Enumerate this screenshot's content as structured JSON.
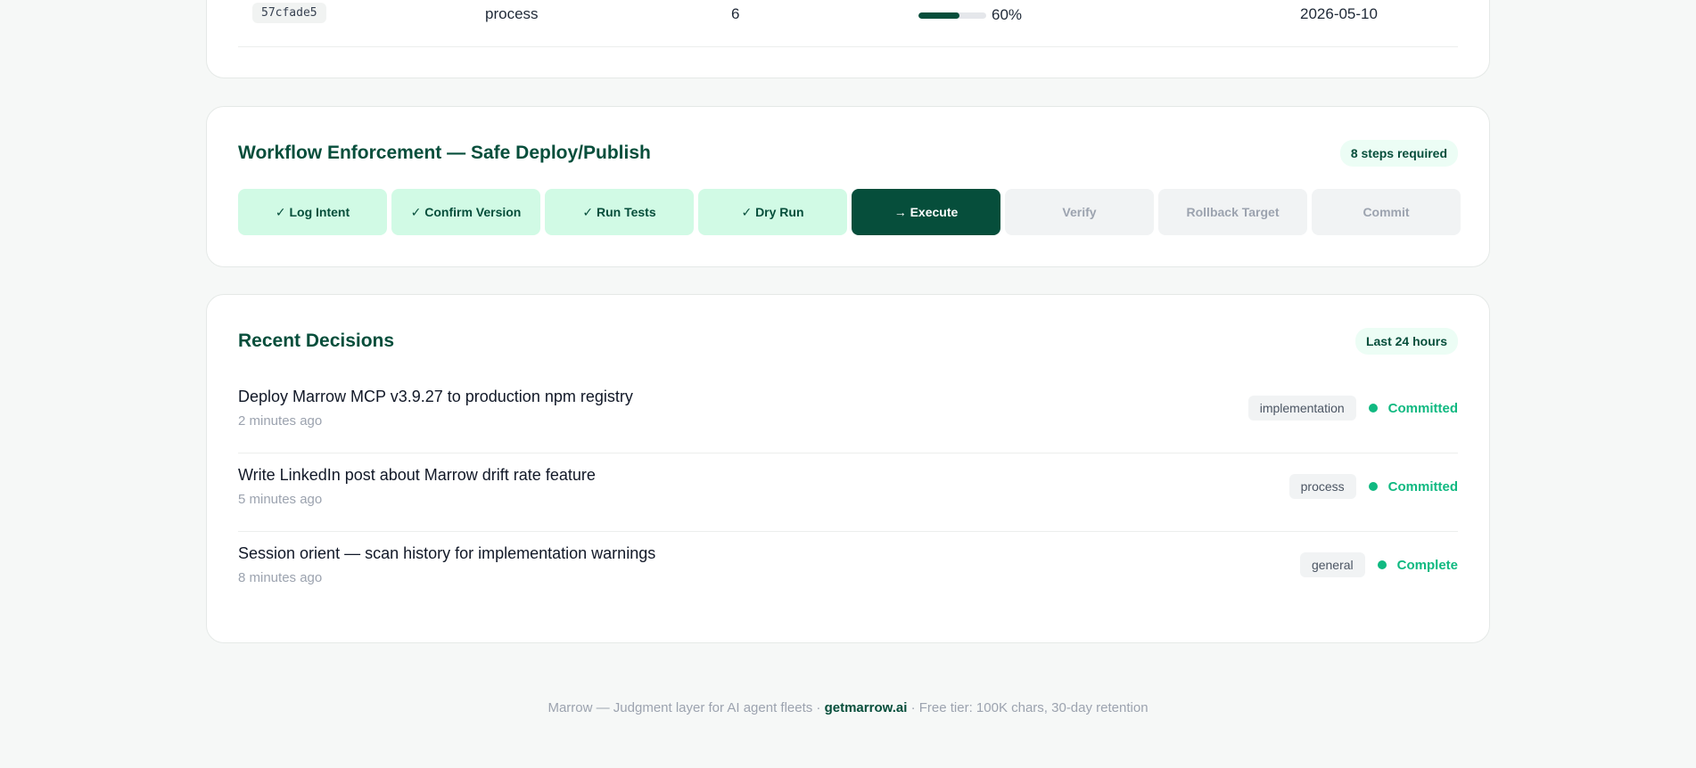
{
  "table_row": {
    "hash": "57cfade5",
    "category": "process",
    "count": "6",
    "progress": 0.6,
    "progress_label": "60%",
    "date": "2026-05-10"
  },
  "workflow": {
    "title": "Workflow Enforcement — Safe Deploy/Publish",
    "badge": "8 steps required",
    "steps": [
      {
        "label": "✓ Log Intent",
        "state": "done"
      },
      {
        "label": "✓ Confirm Version",
        "state": "done"
      },
      {
        "label": "✓ Run Tests",
        "state": "done"
      },
      {
        "label": "✓ Dry Run",
        "state": "done"
      },
      {
        "label": "→ Execute",
        "state": "current"
      },
      {
        "label": "Verify",
        "state": "pending"
      },
      {
        "label": "Rollback Target",
        "state": "pending"
      },
      {
        "label": "Commit",
        "state": "pending"
      }
    ]
  },
  "decisions": {
    "title": "Recent Decisions",
    "badge": "Last 24 hours",
    "items": [
      {
        "title": "Deploy Marrow MCP v3.9.27 to production npm registry",
        "time": "2 minutes ago",
        "tag": "implementation",
        "status": "Committed"
      },
      {
        "title": "Write LinkedIn post about Marrow drift rate feature",
        "time": "5 minutes ago",
        "tag": "process",
        "status": "Committed"
      },
      {
        "title": "Session orient — scan history for implementation warnings",
        "time": "8 minutes ago",
        "tag": "general",
        "status": "Complete"
      }
    ]
  },
  "footer": {
    "prefix": "Marrow — Judgment layer for AI agent fleets · ",
    "link": "getmarrow.ai",
    "suffix": " · Free tier: 100K chars, 30-day retention"
  },
  "colors": {
    "brand": "#064e3b",
    "success": "#10b981",
    "done_bg": "#d1fae5"
  }
}
